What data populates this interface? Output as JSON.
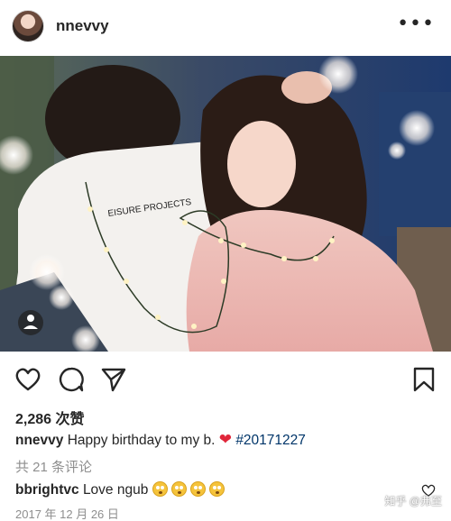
{
  "post": {
    "author": "nnevvy",
    "more_icon": "more-horizontal-icon",
    "photo_print_text": "EISURE PROJECTS",
    "likes_label": "2,286 次赞",
    "caption": {
      "username": "nnevvy",
      "text": "Happy birthday to my b.",
      "heart": "❤",
      "hashtag": "#20171227"
    },
    "comments_link": "共 21 条评论",
    "comment": {
      "username": "bbrightvc",
      "text": "Love ngub"
    },
    "date": "2017 年 12 月 26 日"
  },
  "watermark": "知乎 @弗至",
  "colors": {
    "text": "#262626",
    "muted": "#8e8e8e",
    "hashtag": "#003569",
    "heart": "#e0263a"
  }
}
